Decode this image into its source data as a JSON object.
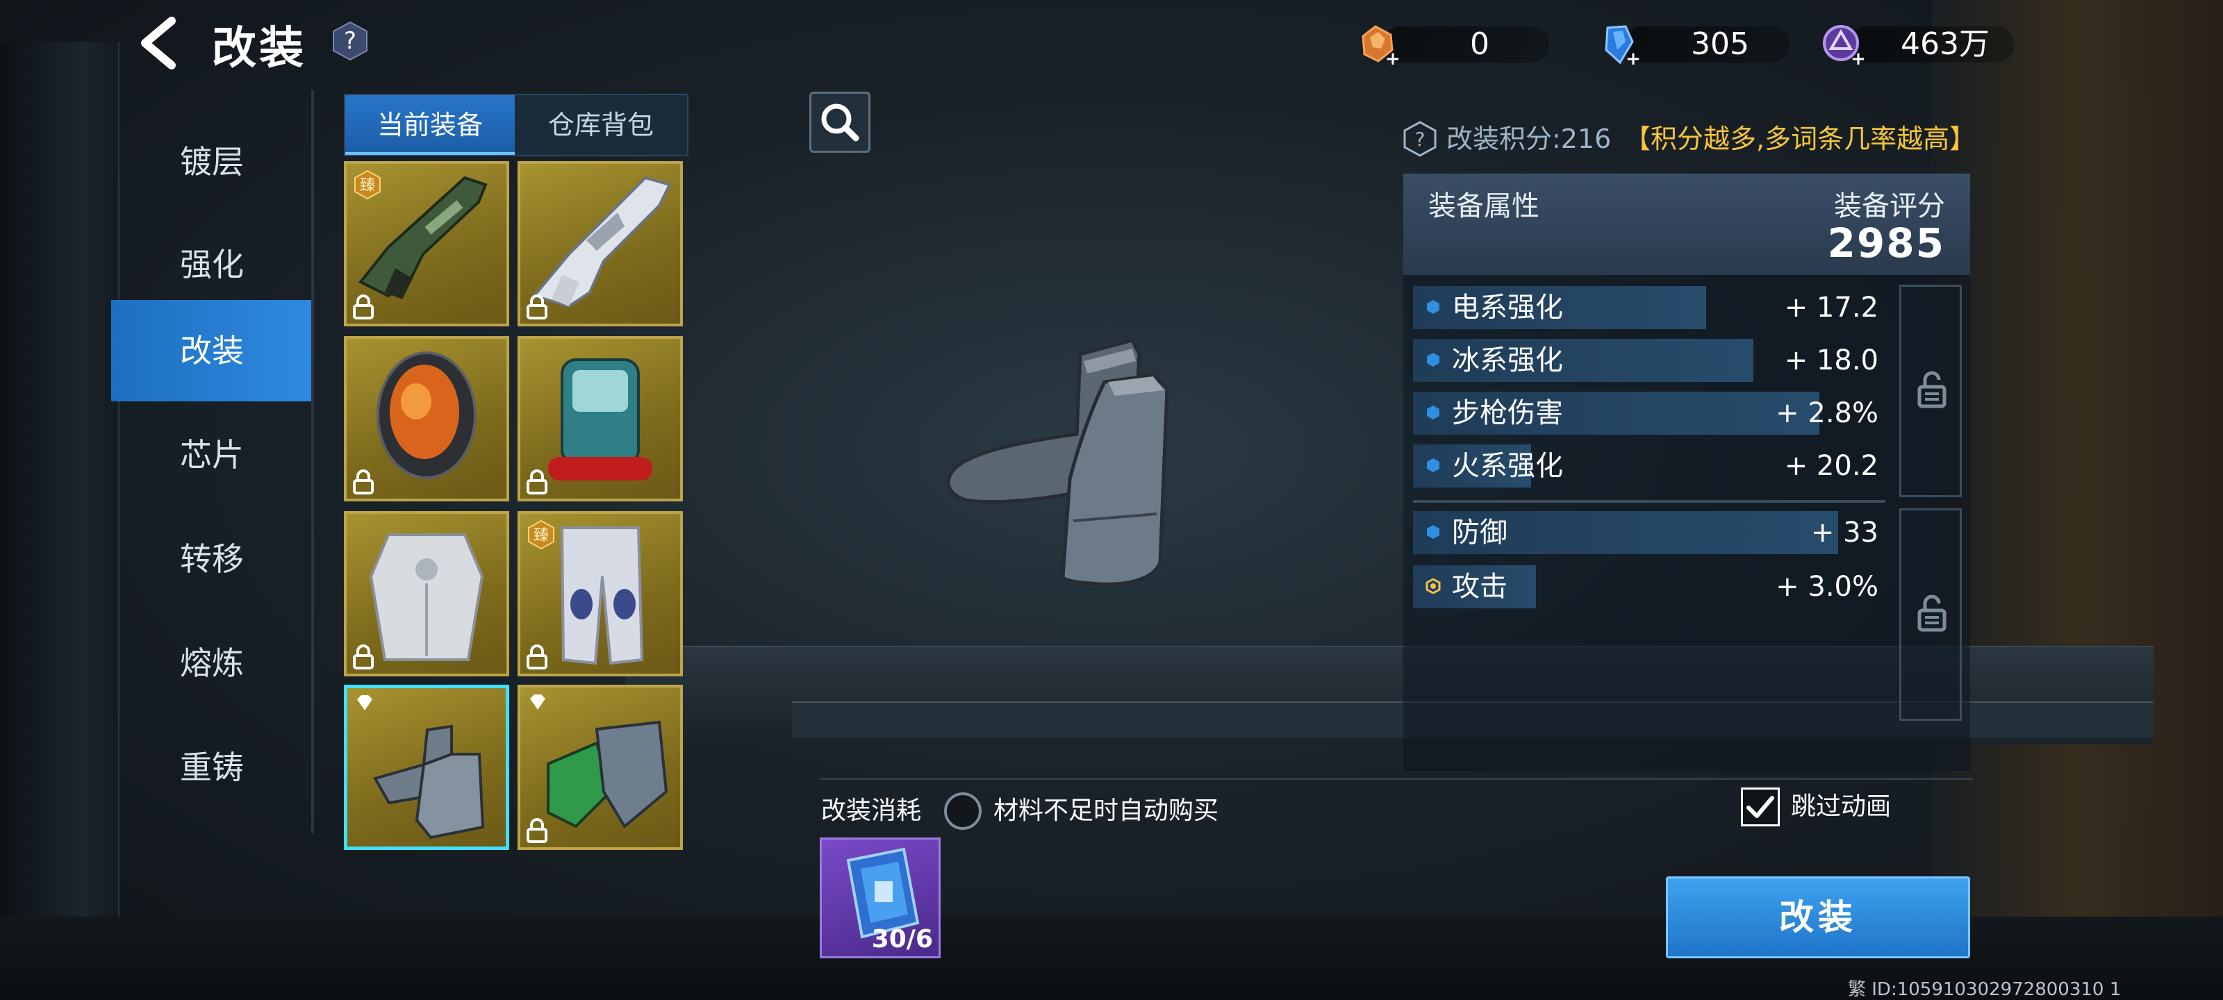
{
  "header": {
    "title": "改装",
    "back_icon": "back-arrow-icon",
    "help_icon": "question-icon"
  },
  "currencies": [
    {
      "icon": "orange-ore-icon",
      "value": "0"
    },
    {
      "icon": "blue-crystal-icon",
      "value": "305"
    },
    {
      "icon": "purple-coin-icon",
      "value": "463万"
    }
  ],
  "side_nav": {
    "items": [
      "镀层",
      "强化",
      "改装",
      "芯片",
      "转移",
      "熔炼",
      "重铸"
    ],
    "active_index": 2
  },
  "tabs": {
    "items": [
      "当前装备",
      "仓库背包"
    ],
    "active_index": 0
  },
  "equipment": {
    "slots": [
      {
        "item": "rifle",
        "badge": "臻",
        "locked": true
      },
      {
        "item": "white-rifle",
        "locked": true
      },
      {
        "item": "helmet",
        "locked": true
      },
      {
        "item": "backpack",
        "locked": true
      },
      {
        "item": "armor",
        "locked": true
      },
      {
        "item": "pants",
        "badge": "臻",
        "locked": true
      },
      {
        "item": "boots",
        "gem": true,
        "selected": true
      },
      {
        "item": "gloves",
        "gem": true,
        "locked": true
      }
    ]
  },
  "score_line": {
    "label": "改装积分:216",
    "hint": "【积分越多,多词条几率越高】"
  },
  "stats": {
    "header_left": "装备属性",
    "header_right": "装备评分",
    "score": "2985",
    "rows": [
      {
        "name": "电系强化",
        "value": "+ 17.2",
        "fill": 0.62
      },
      {
        "name": "冰系强化",
        "value": "+ 18.0",
        "fill": 0.72
      },
      {
        "name": "步枪伤害",
        "value": "+ 2.8%",
        "fill": 0.86
      },
      {
        "name": "火系强化",
        "value": "+ 20.2",
        "fill": 0.25
      },
      {
        "name": "防御",
        "value": "+ 33",
        "fill": 0.9
      },
      {
        "name": "攻击",
        "value": "+ 3.0%",
        "fill": 0.26
      }
    ]
  },
  "cost": {
    "label": "改装消耗",
    "auto_buy_label": "材料不足时自动购买",
    "material_count": "30/6"
  },
  "skip_animation": {
    "label": "跳过动画",
    "checked": true
  },
  "action_button": "改装",
  "footer_id": "繁  ID:105910302972800310 1"
}
